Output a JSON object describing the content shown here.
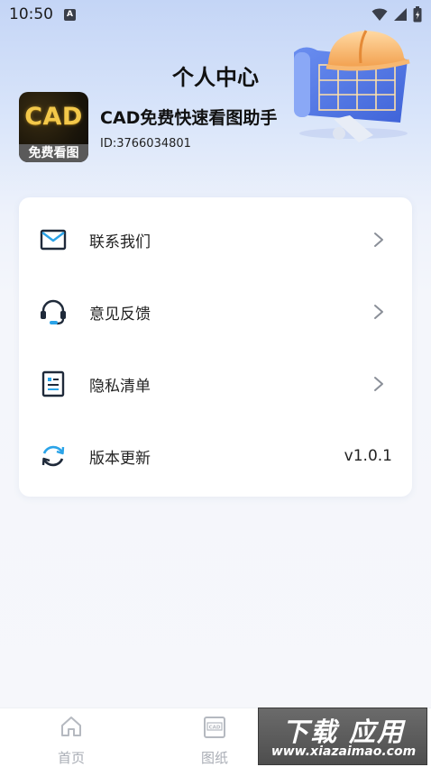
{
  "status_bar": {
    "time": "10:50",
    "notification_badge": "A"
  },
  "header": {
    "title": "个人中心"
  },
  "profile": {
    "logo_text": "CAD",
    "logo_subtext": "免费看图",
    "app_name": "CAD免费快速看图助手",
    "user_id": "ID:3766034801"
  },
  "menu": {
    "items": [
      {
        "label": "联系我们",
        "icon": "mail-icon",
        "trailing": "chevron"
      },
      {
        "label": "意见反馈",
        "icon": "headset-icon",
        "trailing": "chevron"
      },
      {
        "label": "隐私清单",
        "icon": "document-icon",
        "trailing": "chevron"
      },
      {
        "label": "版本更新",
        "icon": "refresh-icon",
        "trailing": "value",
        "value": "v1.0.1"
      }
    ]
  },
  "bottom_nav": {
    "tabs": [
      {
        "label": "首页",
        "icon": "home-icon"
      },
      {
        "label": "图纸",
        "icon": "cad-drawing-icon"
      }
    ]
  },
  "watermark": {
    "title": "下载 应用",
    "url": "www.xiazaimao.com"
  },
  "colors": {
    "accent_blue": "#2aa3e8",
    "icon_dark": "#1f2a3a",
    "text_primary": "#222222",
    "nav_inactive": "#a9adb5"
  }
}
